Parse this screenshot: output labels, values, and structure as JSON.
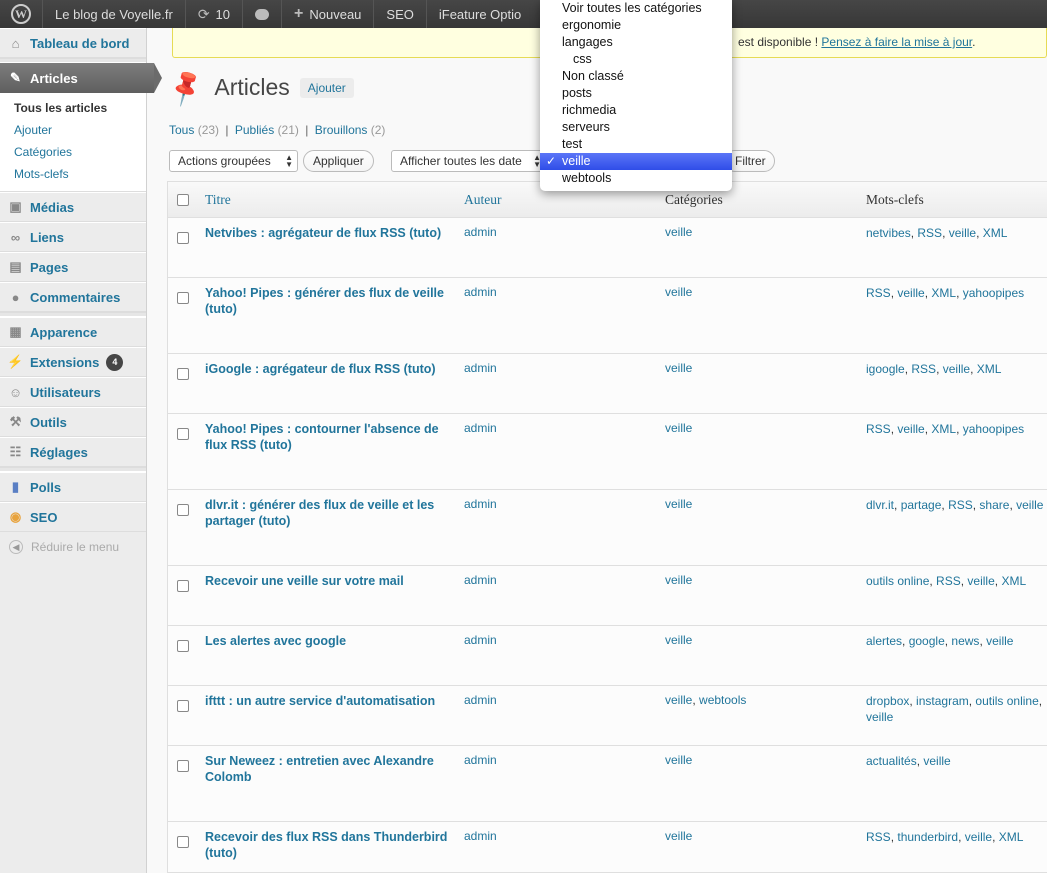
{
  "adminbar": {
    "site": "Le blog de Voyelle.fr",
    "updates": "10",
    "new": "Nouveau",
    "seo": "SEO",
    "ifeature": "iFeature Optio"
  },
  "sidebar": {
    "dashboard": "Tableau de bord",
    "articles": "Articles",
    "sub": [
      "Tous les articles",
      "Ajouter",
      "Catégories",
      "Mots-clefs"
    ],
    "medias": "Médias",
    "liens": "Liens",
    "pages": "Pages",
    "commentaires": "Commentaires",
    "apparence": "Apparence",
    "extensions": "Extensions",
    "extensions_count": "4",
    "utilisateurs": "Utilisateurs",
    "outils": "Outils",
    "reglages": "Réglages",
    "polls": "Polls",
    "seo": "SEO",
    "collapse": "Réduire le menu"
  },
  "notice": {
    "text_end": "est disponible ! ",
    "link": "Pensez à faire la mise à jour"
  },
  "page": {
    "title": "Articles",
    "add_new": "Ajouter"
  },
  "filters": {
    "all": "Tous",
    "all_count": "(23)",
    "published": "Publiés",
    "published_count": "(21)",
    "drafts": "Brouillons",
    "drafts_count": "(2)"
  },
  "tablenav": {
    "bulk_actions": "Actions groupées",
    "apply": "Appliquer",
    "dates": "Afficher toutes les date",
    "filter": "Filtrer"
  },
  "dropdown": {
    "options": [
      {
        "label": "Voir toutes les catégories",
        "indent": false,
        "selected": false
      },
      {
        "label": "ergonomie",
        "indent": false,
        "selected": false
      },
      {
        "label": "langages",
        "indent": false,
        "selected": false
      },
      {
        "label": "css",
        "indent": true,
        "selected": false
      },
      {
        "label": "Non classé",
        "indent": false,
        "selected": false
      },
      {
        "label": "posts",
        "indent": false,
        "selected": false
      },
      {
        "label": "richmedia",
        "indent": false,
        "selected": false
      },
      {
        "label": "serveurs",
        "indent": false,
        "selected": false
      },
      {
        "label": "test",
        "indent": false,
        "selected": false
      },
      {
        "label": "veille",
        "indent": false,
        "selected": true
      },
      {
        "label": "webtools",
        "indent": false,
        "selected": false
      }
    ]
  },
  "table": {
    "headers": {
      "title": "Titre",
      "author": "Auteur",
      "categories": "Catégories",
      "tags": "Mots-clefs"
    },
    "rows": [
      {
        "title": "Netvibes : agrégateur de flux RSS (tuto)",
        "author": "admin",
        "categories": [
          "veille"
        ],
        "tags": [
          "netvibes",
          "RSS",
          "veille",
          "XML"
        ]
      },
      {
        "title": "Yahoo! Pipes : générer des flux de veille (tuto)",
        "author": "admin",
        "categories": [
          "veille"
        ],
        "tags": [
          "RSS",
          "veille",
          "XML",
          "yahoopipes"
        ]
      },
      {
        "title": "iGoogle : agrégateur de flux RSS (tuto)",
        "author": "admin",
        "categories": [
          "veille"
        ],
        "tags": [
          "igoogle",
          "RSS",
          "veille",
          "XML"
        ]
      },
      {
        "title": "Yahoo! Pipes : contourner l'absence de flux RSS (tuto)",
        "author": "admin",
        "categories": [
          "veille"
        ],
        "tags": [
          "RSS",
          "veille",
          "XML",
          "yahoopipes"
        ]
      },
      {
        "title": "dlvr.it : générer des flux de veille et les partager (tuto)",
        "author": "admin",
        "categories": [
          "veille"
        ],
        "tags": [
          "dlvr.it",
          "partage",
          "RSS",
          "share",
          "veille"
        ]
      },
      {
        "title": "Recevoir une veille sur votre mail",
        "author": "admin",
        "categories": [
          "veille"
        ],
        "tags": [
          "outils online",
          "RSS",
          "veille",
          "XML"
        ]
      },
      {
        "title": "Les alertes avec google",
        "author": "admin",
        "categories": [
          "veille"
        ],
        "tags": [
          "alertes",
          "google",
          "news",
          "veille"
        ]
      },
      {
        "title": "ifttt : un autre service d'automatisation",
        "author": "admin",
        "categories": [
          "veille",
          "webtools"
        ],
        "tags": [
          "dropbox",
          "instagram",
          "outils online",
          "veille"
        ]
      },
      {
        "title": "Sur Neweez : entretien avec Alexandre Colomb",
        "author": "admin",
        "categories": [
          "veille"
        ],
        "tags": [
          "actualités",
          "veille"
        ]
      },
      {
        "title": "Recevoir des flux RSS dans Thunderbird (tuto)",
        "author": "admin",
        "categories": [
          "veille"
        ],
        "tags": [
          "RSS",
          "thunderbird",
          "veille",
          "XML"
        ]
      }
    ]
  }
}
